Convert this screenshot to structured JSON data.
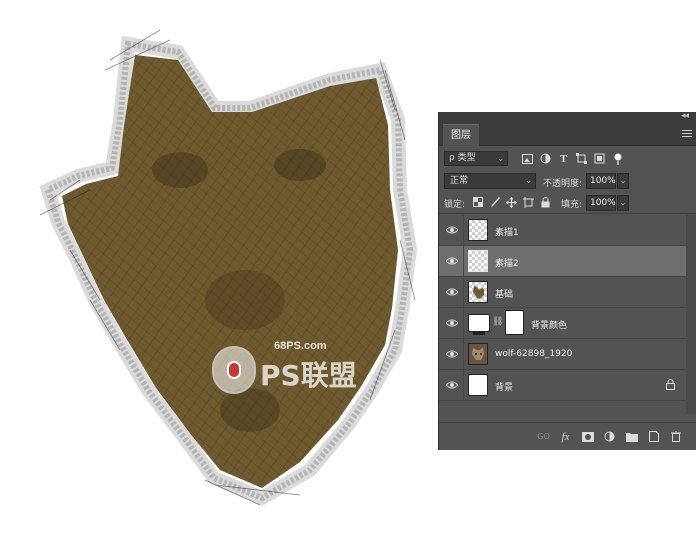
{
  "panel": {
    "tab_label": "图层",
    "collapse_glyph": "◂◂",
    "filter": {
      "value": "ρ 类型"
    },
    "blend_mode": "正常",
    "opacity_label": "不透明度:",
    "opacity_value": "100%",
    "lock_label": "锁定:",
    "fill_label": "填充:",
    "fill_value": "100%"
  },
  "layers": [
    {
      "name": "素描1",
      "thumb": "checker",
      "visible": true,
      "selected": false
    },
    {
      "name": "素描2",
      "thumb": "checker",
      "visible": true,
      "selected": true
    },
    {
      "name": "基础",
      "thumb": "checker",
      "visible": true,
      "selected": false
    },
    {
      "name": "背景颜色",
      "thumb": "white",
      "visible": true,
      "selected": false,
      "has_mask": true
    },
    {
      "name": "wolf-62898_1920",
      "thumb": "photo",
      "visible": true,
      "selected": false
    },
    {
      "name": "背景",
      "thumb": "white",
      "visible": true,
      "selected": false,
      "locked": true
    }
  ],
  "watermark": {
    "domain": "68PS.com",
    "brand": "PS联盟"
  },
  "colors": {
    "panel_bg": "#535353",
    "selected_row": "#6e6e6e",
    "wolf_fill": "#6e5a2e"
  },
  "footer_icons": [
    "link-icon",
    "fx-icon",
    "mask-icon",
    "adjustment-icon",
    "group-icon",
    "new-layer-icon",
    "trash-icon"
  ]
}
